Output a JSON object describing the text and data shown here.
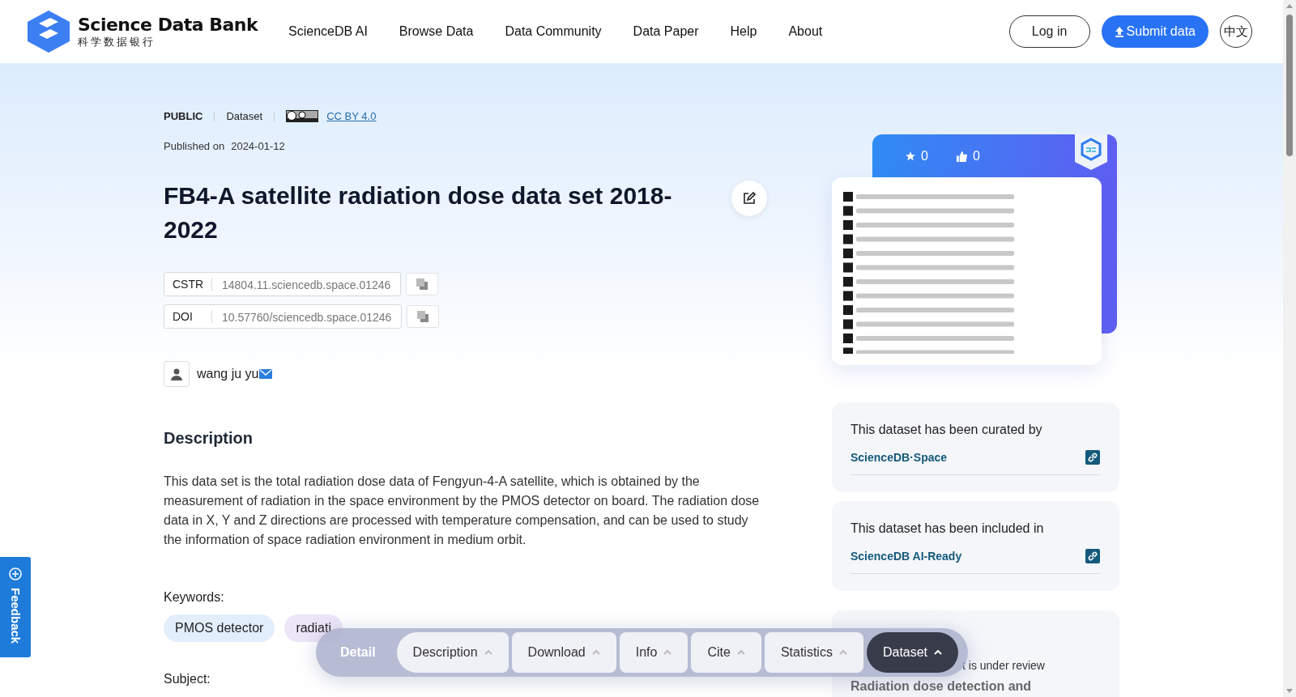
{
  "header": {
    "logo": {
      "title": "Science Data Bank",
      "subtitle": "科学数据银行"
    },
    "nav": [
      {
        "label": "ScienceDB AI"
      },
      {
        "label": "Browse Data"
      },
      {
        "label": "Data Community"
      },
      {
        "label": "Data Paper"
      },
      {
        "label": "Help"
      },
      {
        "label": "About"
      }
    ],
    "login": "Log in",
    "submit": "Submit data",
    "language": "中文"
  },
  "meta": {
    "access": "PUBLIC",
    "type": "Dataset",
    "license": "CC BY 4.0",
    "published_label": "Published on",
    "published_date": "2024-01-12"
  },
  "title": "FB4-A satellite radiation dose data set 2018-2022",
  "identifiers": [
    {
      "label": "CSTR",
      "value": "14804.11.sciencedb.space.01246"
    },
    {
      "label": "DOI",
      "value": "10.57760/sciencedb.space.01246"
    }
  ],
  "authors": [
    {
      "name": "wang ju yu"
    }
  ],
  "description": {
    "heading": "Description",
    "text": "This data set is the total radiation dose data of Fengyun-4-A satellite, which is obtained by the measurement of radiation in the space environment by the PMOS detector on board. The radiation dose data in X, Y and Z directions are processed with temperature compensation, and can be used to study the information of space radiation environment in medium orbit."
  },
  "keywords": {
    "label": "Keywords:",
    "items": [
      {
        "label": "PMOS detector",
        "color": "#e3eefc"
      },
      {
        "label": "radiati",
        "color": "#ede5f8"
      }
    ]
  },
  "subject": {
    "label": "Subject:"
  },
  "stats": {
    "favorites": "0",
    "likes": "0"
  },
  "cards": [
    {
      "heading": "This dataset has been curated by",
      "link": "ScienceDB·Space"
    },
    {
      "heading": "This dataset has been included in",
      "link": "ScienceDB AI-Ready"
    }
  ],
  "review_card": {
    "text": "t is under review",
    "title": "Radiation dose detection and"
  },
  "section_tabs": [
    {
      "label": "Detail",
      "kind": "label"
    },
    {
      "label": "Description",
      "kind": "tab",
      "selected": false
    },
    {
      "label": "Download",
      "kind": "tab",
      "selected": false
    },
    {
      "label": "Info",
      "kind": "tab",
      "selected": false
    },
    {
      "label": "Cite",
      "kind": "tab",
      "selected": false
    },
    {
      "label": "Statistics",
      "kind": "tab",
      "selected": false
    },
    {
      "label": "Dataset",
      "kind": "tab",
      "selected": true
    }
  ],
  "feedback": "Feedback"
}
